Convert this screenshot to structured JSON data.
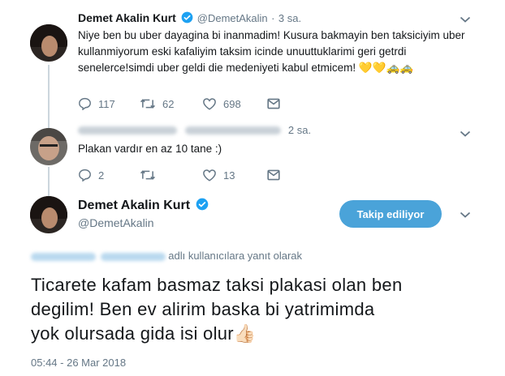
{
  "tweet1": {
    "name": "Demet Akalin Kurt",
    "handle": "@DemetAkalin",
    "separator": "·",
    "time": "3 sa.",
    "text_line1": "Niye ben bu uber dayagina bi inanmadim! Kusura bakmayin ben taksiciyim uber",
    "text_line2": "kullanmiyorum eski kafaliyim taksim icinde unuuttuklarimi geri getrdi",
    "text_line3": "senelerce!simdi uber geldi die medeniyeti kabul etmicem! 💛💛🚕🚕",
    "replies": "117",
    "retweets": "62",
    "likes": "698"
  },
  "tweet2": {
    "time": "2 sa.",
    "text": "Plakan vardır en az 10 tane :)",
    "replies": "2",
    "retweets": "",
    "likes": "13"
  },
  "main_tweet": {
    "name": "Demet Akalin Kurt",
    "handle": "@DemetAkalin",
    "follow_label": "Takip ediliyor",
    "reply_to_suffix": "adlı kullanıcılara yanıt olarak",
    "text_line1": "Ticarete kafam basmaz taksi plakasi olan ben",
    "text_line2": "degilim! Ben ev alirim baska bi yatrimimda",
    "text_line3": "yok olursada gida isi olur👍🏻",
    "timestamp": "05:44 - 26 Mar 2018"
  },
  "colors": {
    "accent": "#1da1f2",
    "follow_button": "#4aa3d9",
    "muted": "#657786"
  },
  "icons": [
    "verified-badge-icon",
    "chevron-down-icon",
    "reply-icon",
    "retweet-icon",
    "like-icon",
    "dm-icon"
  ]
}
